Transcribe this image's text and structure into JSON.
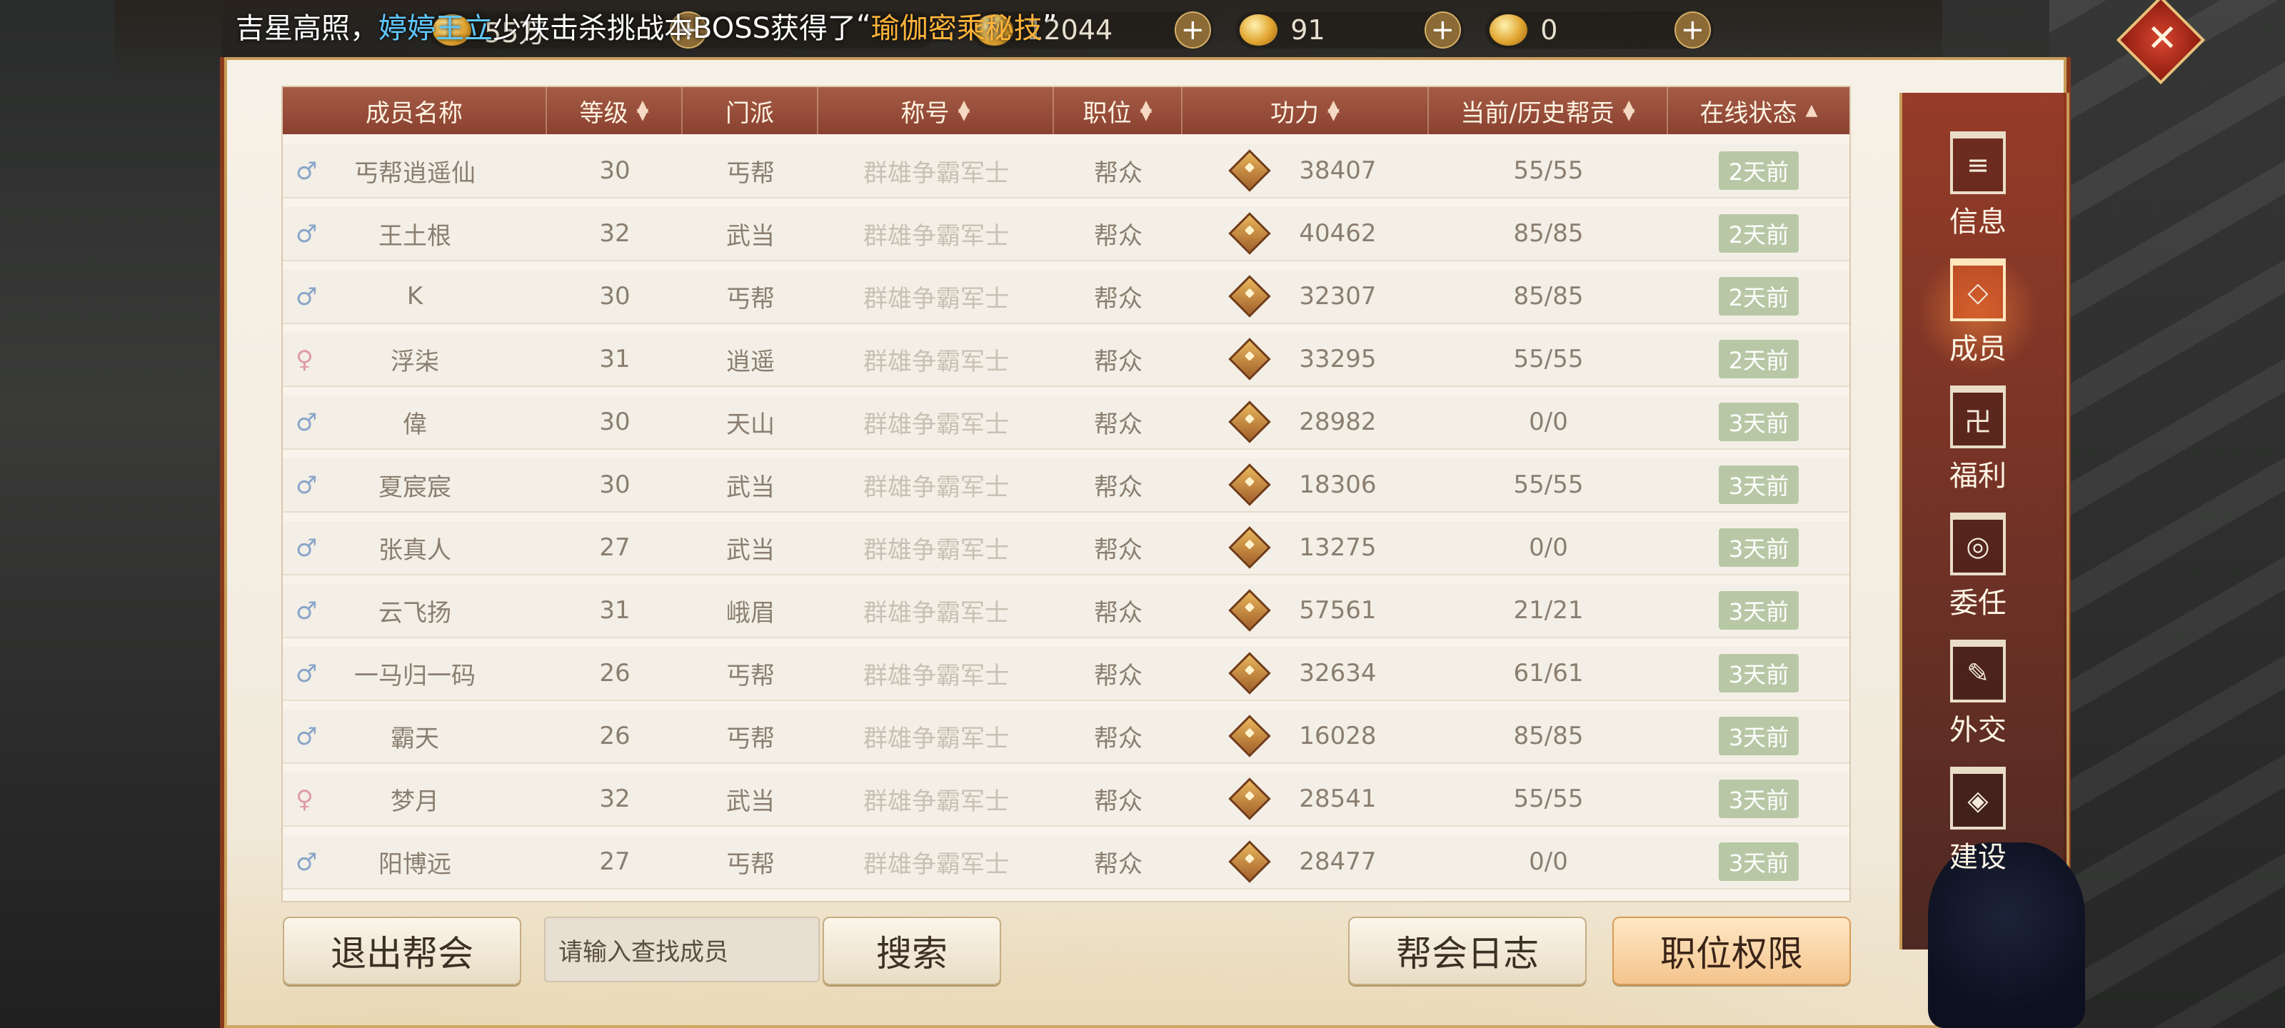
{
  "ticker": {
    "prefix": "吉星高照，",
    "player": "婷婷王立",
    "middle": "少侠击杀挑战本BOSS获得了",
    "quote_open": "“",
    "item": "瑜伽密乘秘技",
    "quote_close": "”"
  },
  "currency": [
    {
      "name": "coin",
      "value": "55万"
    },
    {
      "name": "silver",
      "value": "12044"
    },
    {
      "name": "gold",
      "value": "91"
    },
    {
      "name": "ingot",
      "value": "0"
    }
  ],
  "close_glyph": "✕",
  "table": {
    "headers": [
      "成员名称",
      "等级",
      "门派",
      "称号",
      "职位",
      "功力",
      "当前/历史帮贡",
      "在线状态"
    ],
    "rows": [
      {
        "gender": "male",
        "name": "丐帮逍遥仙",
        "level": "30",
        "sect": "丐帮",
        "title": "群雄争霸军士",
        "position": "帮众",
        "power": "38407",
        "contrib": "55/55",
        "status": "2天前"
      },
      {
        "gender": "male",
        "name": "王土根",
        "level": "32",
        "sect": "武当",
        "title": "群雄争霸军士",
        "position": "帮众",
        "power": "40462",
        "contrib": "85/85",
        "status": "2天前"
      },
      {
        "gender": "male",
        "name": "K",
        "level": "30",
        "sect": "丐帮",
        "title": "群雄争霸军士",
        "position": "帮众",
        "power": "32307",
        "contrib": "85/85",
        "status": "2天前"
      },
      {
        "gender": "female",
        "name": "浮柒",
        "level": "31",
        "sect": "逍遥",
        "title": "群雄争霸军士",
        "position": "帮众",
        "power": "33295",
        "contrib": "55/55",
        "status": "2天前"
      },
      {
        "gender": "male",
        "name": "偉",
        "level": "30",
        "sect": "天山",
        "title": "群雄争霸军士",
        "position": "帮众",
        "power": "28982",
        "contrib": "0/0",
        "status": "3天前"
      },
      {
        "gender": "male",
        "name": "夏宸宸",
        "level": "30",
        "sect": "武当",
        "title": "群雄争霸军士",
        "position": "帮众",
        "power": "18306",
        "contrib": "55/55",
        "status": "3天前"
      },
      {
        "gender": "male",
        "name": "张真人",
        "level": "27",
        "sect": "武当",
        "title": "群雄争霸军士",
        "position": "帮众",
        "power": "13275",
        "contrib": "0/0",
        "status": "3天前"
      },
      {
        "gender": "male",
        "name": "云飞扬",
        "level": "31",
        "sect": "峨眉",
        "title": "群雄争霸军士",
        "position": "帮众",
        "power": "57561",
        "contrib": "21/21",
        "status": "3天前"
      },
      {
        "gender": "male",
        "name": "一马归一码",
        "level": "26",
        "sect": "丐帮",
        "title": "群雄争霸军士",
        "position": "帮众",
        "power": "32634",
        "contrib": "61/61",
        "status": "3天前"
      },
      {
        "gender": "male",
        "name": "霸天",
        "level": "26",
        "sect": "丐帮",
        "title": "群雄争霸军士",
        "position": "帮众",
        "power": "16028",
        "contrib": "85/85",
        "status": "3天前"
      },
      {
        "gender": "female",
        "name": "梦月",
        "level": "32",
        "sect": "武当",
        "title": "群雄争霸军士",
        "position": "帮众",
        "power": "28541",
        "contrib": "55/55",
        "status": "3天前"
      },
      {
        "gender": "male",
        "name": "阳博远",
        "level": "27",
        "sect": "丐帮",
        "title": "群雄争霸军士",
        "position": "帮众",
        "power": "28477",
        "contrib": "0/0",
        "status": "3天前"
      }
    ]
  },
  "controls": {
    "quit_label": "退出帮会",
    "search_placeholder": "请输入查找成员",
    "search_label": "搜索",
    "log_label": "帮会日志",
    "perm_label": "职位权限"
  },
  "sidenav": [
    {
      "label": "信息",
      "glyph": "≡"
    },
    {
      "label": "成员",
      "glyph": "◇"
    },
    {
      "label": "福利",
      "glyph": "卍"
    },
    {
      "label": "委任",
      "glyph": "◎"
    },
    {
      "label": "外交",
      "glyph": "✎"
    },
    {
      "label": "建设",
      "glyph": "◈"
    }
  ]
}
